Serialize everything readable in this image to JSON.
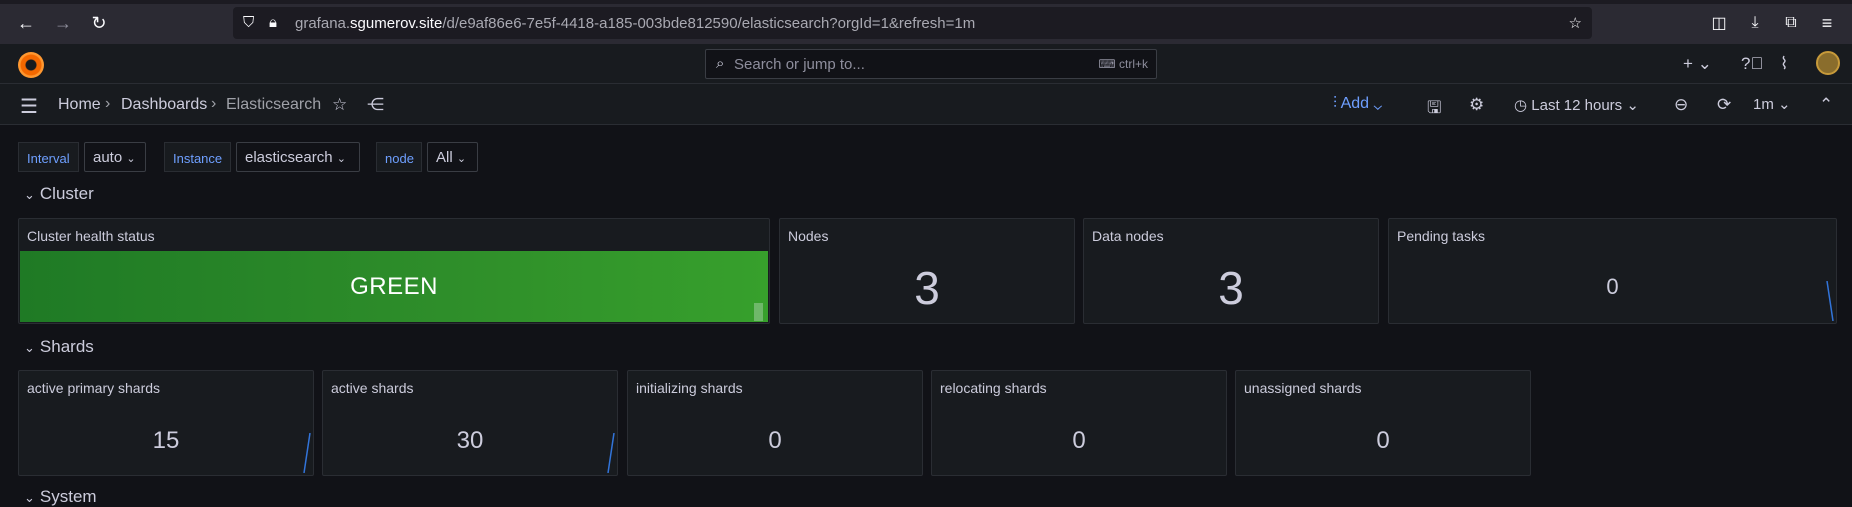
{
  "browser": {
    "url_prefix": "grafana.",
    "url_host": "sgumerov.site",
    "url_path": "/d/e9af86e6-7e5f-4418-a185-003bde812590/elasticsearch?orgId=1&refresh=1m"
  },
  "topbar": {
    "search_placeholder": "Search or jump to...",
    "search_shortcut": "ctrl+k"
  },
  "breadcrumb": {
    "home": "Home",
    "dashboards": "Dashboards",
    "current": "Elasticsearch"
  },
  "toolbar": {
    "add_label": "Add",
    "time_range": "Last 12 hours",
    "refresh_interval": "1m"
  },
  "variables": {
    "interval_label": "Interval",
    "interval_value": "auto",
    "instance_label": "Instance",
    "instance_value": "elasticsearch",
    "node_label": "node",
    "node_value": "All"
  },
  "rows": {
    "cluster": "Cluster",
    "shards": "Shards",
    "system": "System"
  },
  "cluster_panels": {
    "health_title": "Cluster health status",
    "health_value": "GREEN",
    "nodes_title": "Nodes",
    "nodes_value": "3",
    "data_nodes_title": "Data nodes",
    "data_nodes_value": "3",
    "pending_title": "Pending tasks",
    "pending_value": "0"
  },
  "shard_panels": [
    {
      "title": "active primary shards",
      "value": "15"
    },
    {
      "title": "active shards",
      "value": "30"
    },
    {
      "title": "initializing shards",
      "value": "0"
    },
    {
      "title": "relocating shards",
      "value": "0"
    },
    {
      "title": "unassigned shards",
      "value": "0"
    }
  ],
  "colors": {
    "accent": "#6e9fff",
    "health_green": "#37a02c",
    "sparkline": "#3274d9"
  }
}
